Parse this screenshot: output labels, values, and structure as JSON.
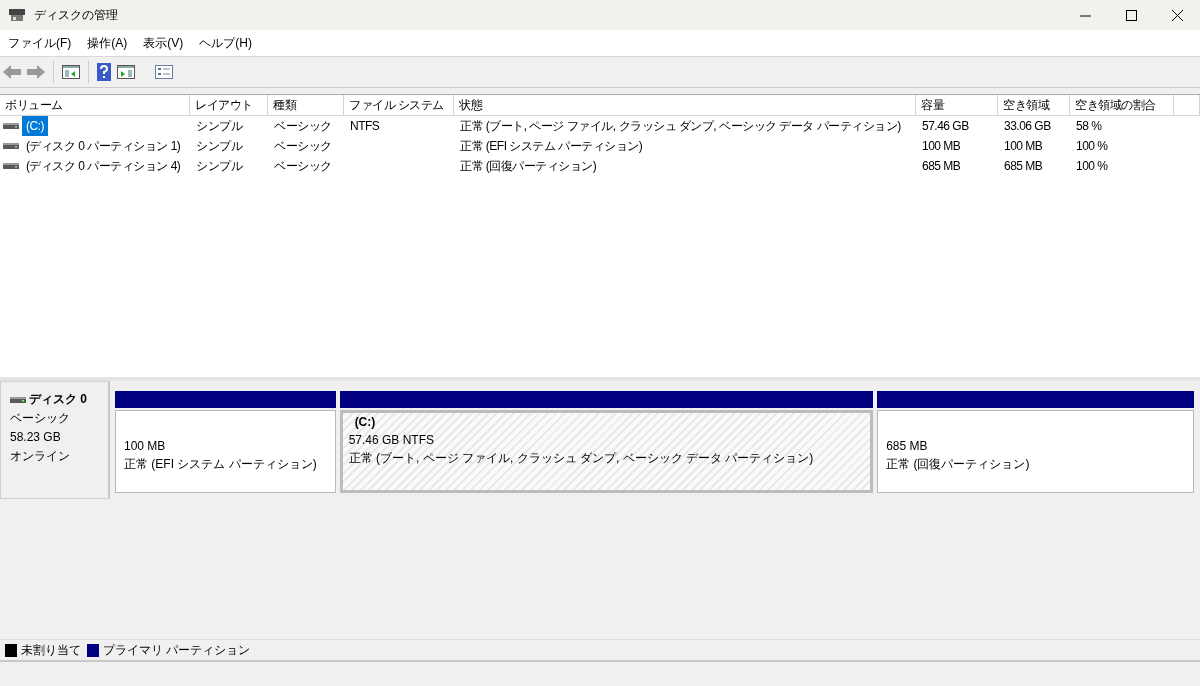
{
  "window": {
    "title": "ディスクの管理"
  },
  "menu": [
    "ファイル(F)",
    "操作(A)",
    "表示(V)",
    "ヘルプ(H)"
  ],
  "table": {
    "columns": [
      "ボリューム",
      "レイアウト",
      "種類",
      "ファイル システム",
      "状態",
      "容量",
      "空き領域",
      "空き領域の割合"
    ],
    "rows": [
      {
        "selected": true,
        "cells": [
          "(C:)",
          "シンプル",
          "ベーシック",
          "NTFS",
          "正常 (ブート, ページ ファイル, クラッシュ ダンプ, ベーシック データ パーティション)",
          "57.46 GB",
          "33.06 GB",
          "58 %"
        ]
      },
      {
        "selected": false,
        "cells": [
          "(ディスク 0 パーティション 1)",
          "シンプル",
          "ベーシック",
          "",
          "正常 (EFI システム パーティション)",
          "100 MB",
          "100 MB",
          "100 %"
        ]
      },
      {
        "selected": false,
        "cells": [
          "(ディスク 0 パーティション 4)",
          "シンプル",
          "ベーシック",
          "",
          "正常 (回復パーティション)",
          "685 MB",
          "685 MB",
          "100 %"
        ]
      }
    ]
  },
  "disk": {
    "name": "ディスク 0",
    "type": "ベーシック",
    "size": "58.23 GB",
    "status": "オンライン",
    "partitions": [
      {
        "kind": "primary",
        "selected": false,
        "size": "100 MB",
        "status": "正常 (EFI システム パーティション)"
      },
      {
        "kind": "primary",
        "selected": true,
        "label": "(C:)",
        "size": "57.46 GB NTFS",
        "status": "正常 (ブート, ページ ファイル, クラッシュ ダンプ, ベーシック データ パーティション)"
      },
      {
        "kind": "primary",
        "selected": false,
        "size": "685 MB",
        "status": "正常 (回復パーティション)"
      }
    ]
  },
  "legend": [
    {
      "label": "未割り当て",
      "color": "#000000"
    },
    {
      "label": "プライマリ パーティション",
      "color": "#000080"
    }
  ]
}
